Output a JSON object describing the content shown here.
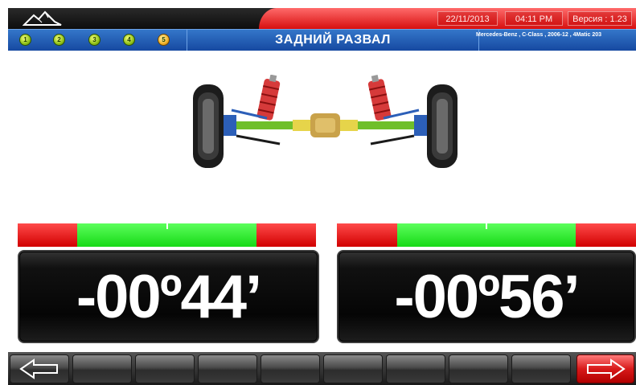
{
  "status": {
    "date": "22/11/2013",
    "time": "04:11 PM",
    "version": "Версия : 1.23"
  },
  "header": {
    "title": "ЗАДНИЙ РАЗВАЛ",
    "vehicle": "Mercedes-Benz , C-Class , 2006-12 , 4Matic 203",
    "steps": [
      "1",
      "2",
      "3",
      "4",
      "5"
    ],
    "active_step": 5
  },
  "measurements": {
    "left": {
      "value": "-00º44’",
      "gauge_indicator": 0.5
    },
    "right": {
      "value": "-00º56’",
      "gauge_indicator": 0.5
    }
  },
  "toolbar": {
    "back_icon": "arrow-left-icon",
    "forward_icon": "arrow-right-icon",
    "blank_buttons": 8
  },
  "colors": {
    "header_blue": "#1f5bb0",
    "status_red": "#e52222",
    "gauge_green": "#22e022",
    "gauge_red": "#e01010"
  }
}
